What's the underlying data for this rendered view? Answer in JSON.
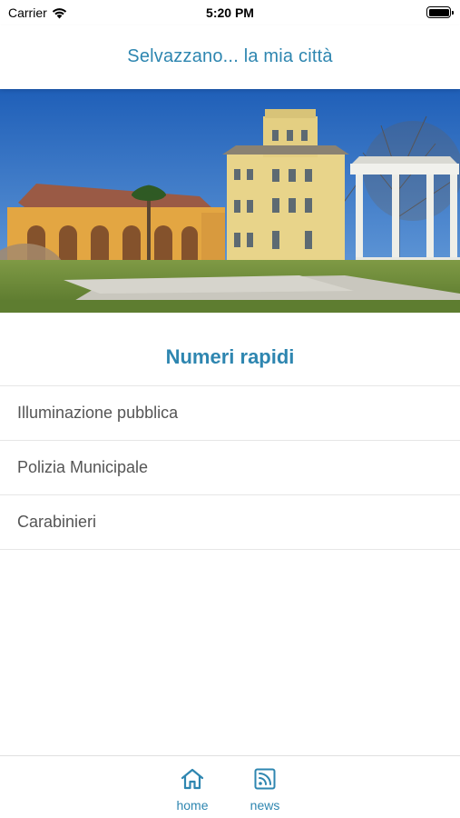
{
  "status_bar": {
    "carrier": "Carrier",
    "time": "5:20 PM"
  },
  "header": {
    "title": "Selvazzano... la mia città"
  },
  "section": {
    "title": "Numeri rapidi"
  },
  "quick_numbers": [
    {
      "label": "Illuminazione pubblica"
    },
    {
      "label": "Polizia Municipale"
    },
    {
      "label": "Carabinieri"
    }
  ],
  "tab_bar": {
    "home": {
      "label": "home",
      "icon": "home-icon"
    },
    "news": {
      "label": "news",
      "icon": "rss-icon"
    }
  },
  "colors": {
    "accent": "#2e86b0",
    "sky": "#3a76c6",
    "grass": "#6d8c3a"
  }
}
